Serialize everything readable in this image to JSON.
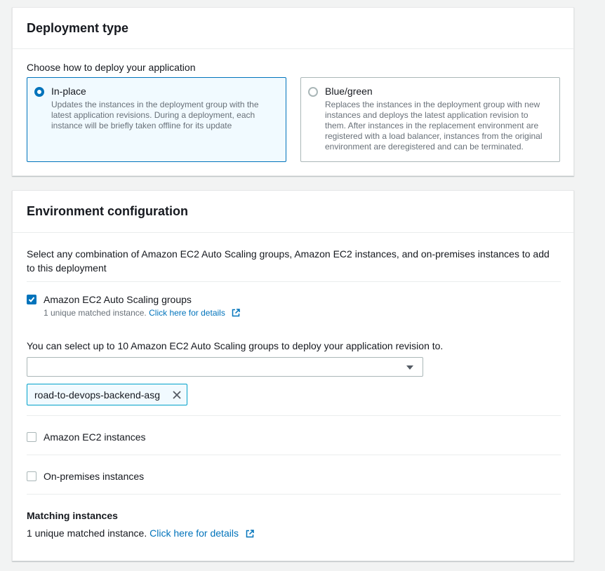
{
  "deployment_type": {
    "title": "Deployment type",
    "prompt": "Choose how to deploy your application",
    "options": [
      {
        "label": "In-place",
        "description": "Updates the instances in the deployment group with the latest application revisions. During a deployment, each instance will be briefly taken offline for its update",
        "selected": true
      },
      {
        "label": "Blue/green",
        "description": "Replaces the instances in the deployment group with new instances and deploys the latest application revision to them. After instances in the replacement environment are registered with a load balancer, instances from the original environment are deregistered and can be terminated.",
        "selected": false
      }
    ]
  },
  "environment": {
    "title": "Environment configuration",
    "description": "Select any combination of Amazon EC2 Auto Scaling groups, Amazon EC2 instances, and on-premises instances to add to this deployment",
    "asg": {
      "label": "Amazon EC2 Auto Scaling groups",
      "checked": true,
      "sub_text": "1 unique matched instance.",
      "link_text": "Click here for details",
      "select_hint": "You can select up to 10 Amazon EC2 Auto Scaling groups to deploy your application revision to.",
      "select_value": "",
      "selected_token": "road-to-devops-backend-asg"
    },
    "ec2": {
      "label": "Amazon EC2 instances",
      "checked": false
    },
    "onprem": {
      "label": "On-premises instances",
      "checked": false
    },
    "matching": {
      "title": "Matching instances",
      "text": "1 unique matched instance.",
      "link_text": "Click here for details"
    }
  },
  "colors": {
    "accent": "#0073bb",
    "token_border": "#00a1c9",
    "selected_bg": "#f1faff"
  }
}
